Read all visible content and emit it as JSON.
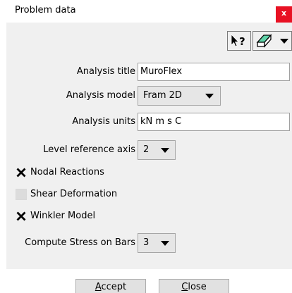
{
  "window": {
    "title": "Problem data",
    "close_glyph": "x"
  },
  "toolbar": {
    "help_icon": "whats-this-help-icon",
    "help_glyph": "?",
    "eraser_icon": "eraser-icon"
  },
  "fields": {
    "analysis_title": {
      "label": "Analysis title",
      "value": "MuroFlex"
    },
    "analysis_model": {
      "label": "Analysis model",
      "value": "Fram 2D"
    },
    "analysis_units": {
      "label": "Analysis units",
      "value": "kN m s C"
    },
    "level_reference_axis": {
      "label": "Level reference axis",
      "value": "2"
    },
    "compute_stress_on_bars": {
      "label": "Compute Stress on Bars",
      "value": "3"
    }
  },
  "checkboxes": {
    "nodal_reactions": {
      "label": "Nodal Reactions",
      "checked": true
    },
    "shear_deformation": {
      "label": "Shear Deformation",
      "checked": false
    },
    "winkler_model": {
      "label": "Winkler Model",
      "checked": true
    }
  },
  "buttons": {
    "accept": {
      "mnemonic": "A",
      "rest": "ccept"
    },
    "close": {
      "mnemonic": "C",
      "rest": "lose"
    }
  },
  "colors": {
    "panel": "#f0f0f0",
    "close_red": "#e81123"
  }
}
